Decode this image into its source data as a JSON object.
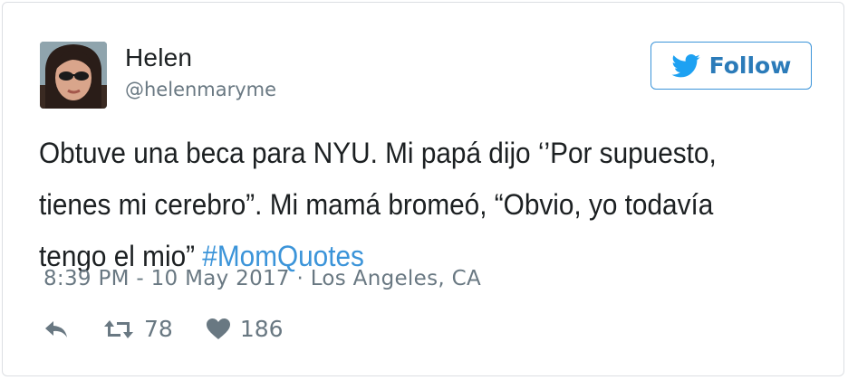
{
  "tweet": {
    "user": {
      "name": "Helen",
      "handle": "@helenmaryme"
    },
    "follow_label": "Follow",
    "text_plain": "Obtuve una beca para NYU. Mi papá dijo ‘’Por supuesto, tienes mi cerebro”. Mi mamá bromeó, “Obvio, yo todavía tengo el mio” ",
    "hashtag": "#MomQuotes",
    "meta": "8:39 PM - 10 May 2017 · Los Angeles, CA",
    "retweet_count": "78",
    "like_count": "186"
  },
  "colors": {
    "link": "#3b94d9",
    "follow_text": "#2b7bb9",
    "muted": "#697882",
    "text": "#1c2022"
  },
  "icons": [
    "twitter-bird-icon",
    "reply-icon",
    "retweet-icon",
    "heart-icon"
  ]
}
